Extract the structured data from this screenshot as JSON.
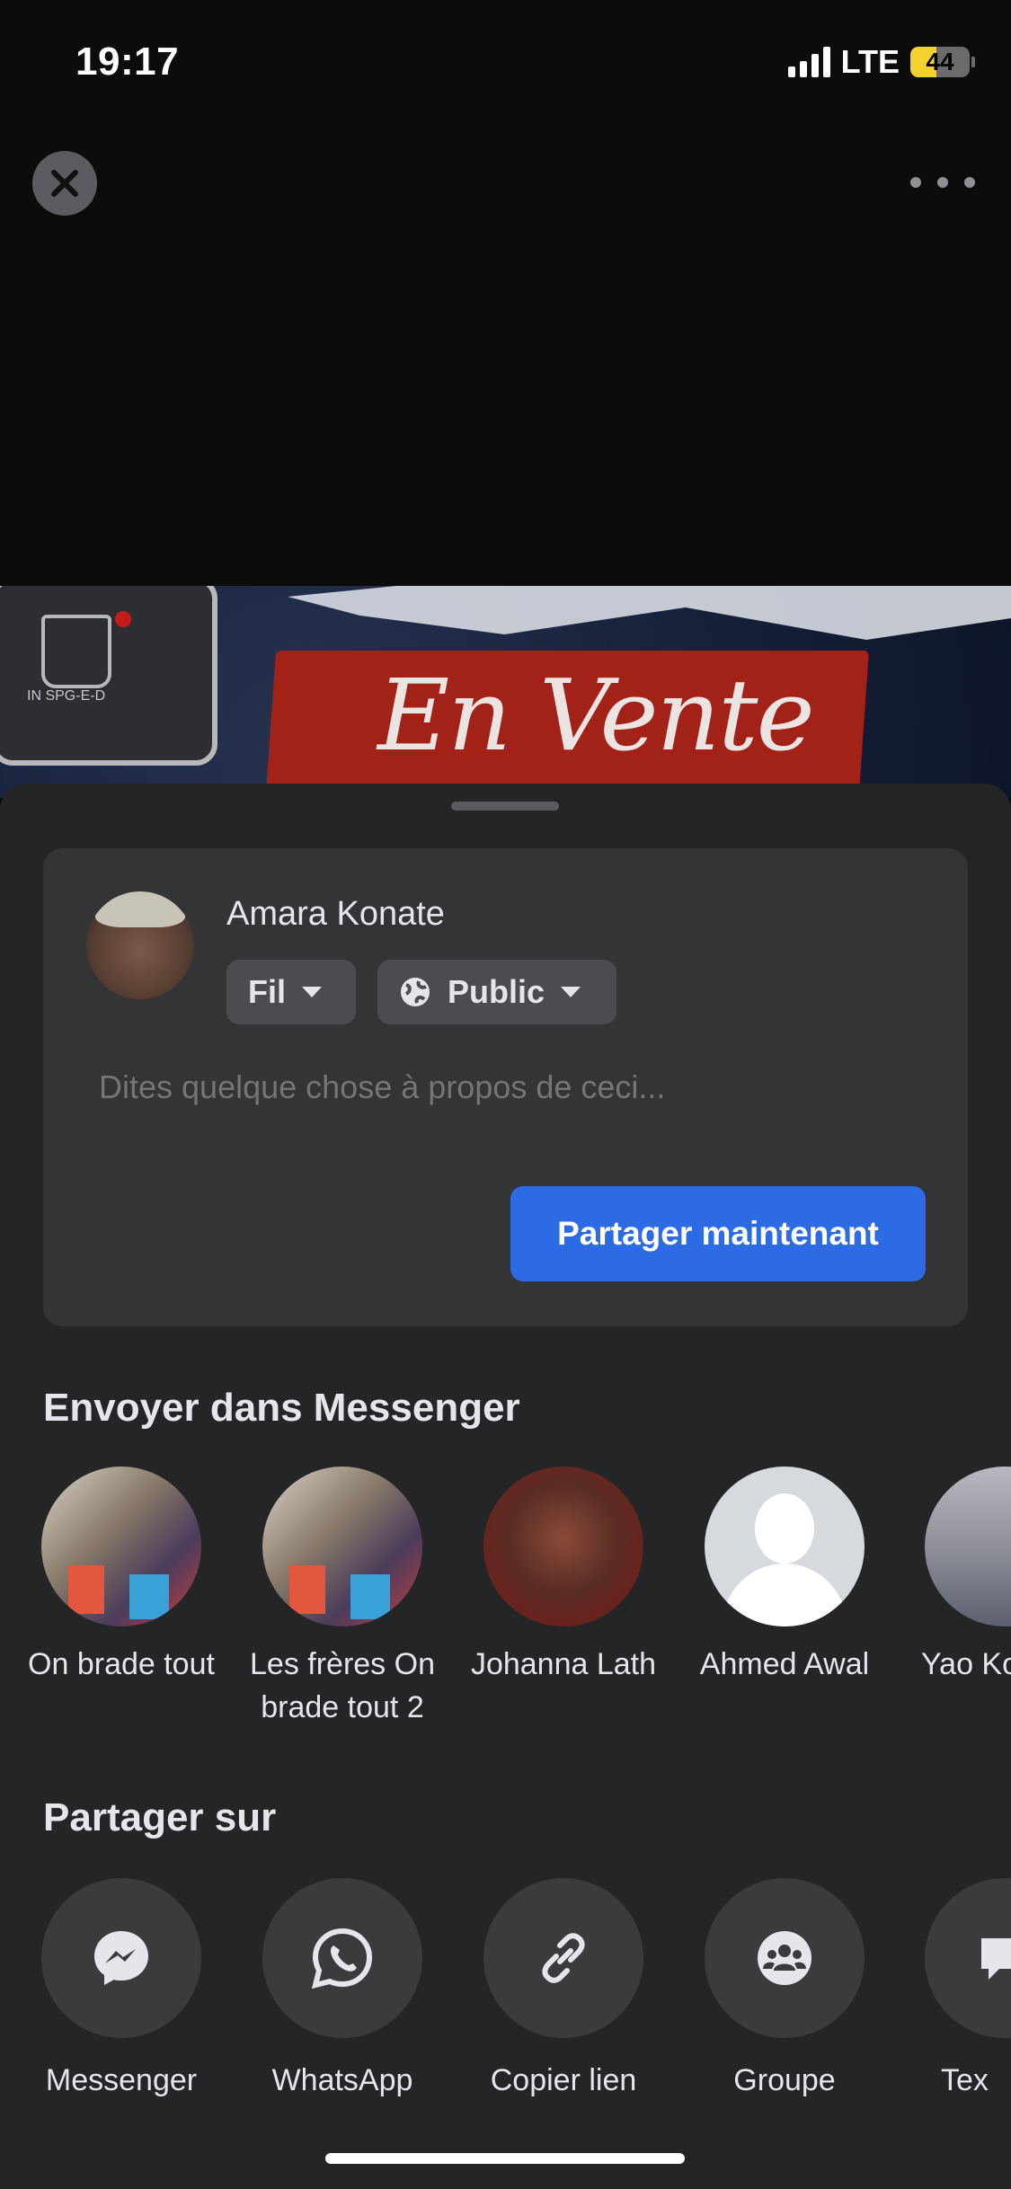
{
  "status_bar": {
    "time": "19:17",
    "network": "LTE",
    "battery": "44",
    "battery_level": 0.44
  },
  "media": {
    "banner_text": "En Vente",
    "logo_text": "IN SPG-E-D"
  },
  "composer": {
    "user_name": "Amara Konate",
    "audience_feed": "Fil",
    "privacy": "Public",
    "placeholder": "Dites quelque chose à propos de ceci...",
    "share_now": "Partager maintenant"
  },
  "messenger_section": {
    "title": "Envoyer dans Messenger",
    "contacts": [
      {
        "name": "On brade tout"
      },
      {
        "name": "Les frères On brade tout 2"
      },
      {
        "name": "Johanna Lath"
      },
      {
        "name": "Ahmed Awal"
      },
      {
        "name": "Yao Ko Kev"
      }
    ]
  },
  "share_section": {
    "title": "Partager sur",
    "options": [
      {
        "label": "Messenger",
        "icon": "messenger-icon"
      },
      {
        "label": "WhatsApp",
        "icon": "whatsapp-icon"
      },
      {
        "label": "Copier lien",
        "icon": "link-icon"
      },
      {
        "label": "Groupe",
        "icon": "group-icon"
      },
      {
        "label": "Tex",
        "icon": "chat-bubble-icon"
      }
    ]
  }
}
